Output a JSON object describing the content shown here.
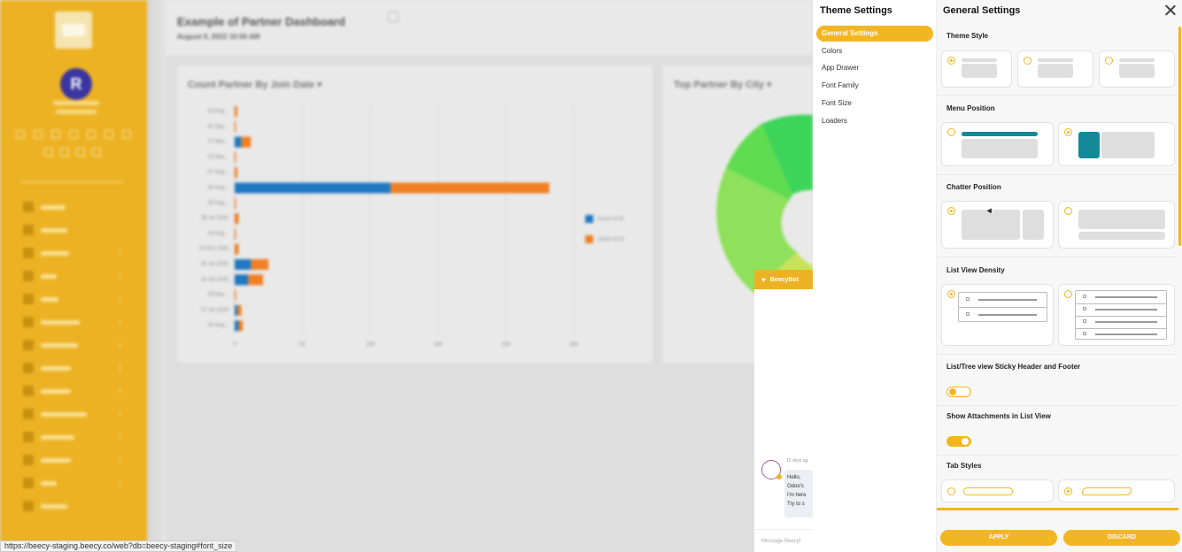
{
  "background": {
    "avatar_letter": "R",
    "title": "Example of Partner Dashboard",
    "date": "August 9, 2023 10:56 AM",
    "chart_card_title": "Count Partner By Join Date",
    "city_card_title": "Top Partner By City",
    "chart_data": {
      "type": "bar",
      "orientation": "horizontal",
      "stacked": true,
      "categories": [
        "23 Aug...",
        "18 Sep...",
        "27 Mar...",
        "13 Mar...",
        "07 Aug...",
        "28 Aug...",
        "25 Aug...",
        "26 Jul 2023",
        "19 Aug...",
        "03 Oct 2023",
        "25 Jul 2023",
        "24 Jul 2023",
        "29 Mar...",
        "27 Jul 2023",
        "16 Aug..."
      ],
      "series": [
        {
          "name": "Count of Id",
          "color": "#1f78c1",
          "values": [
            0,
            0,
            5,
            0,
            0,
            115,
            0,
            0,
            0,
            0,
            12,
            10,
            0,
            2,
            3
          ]
        },
        {
          "name": "Count of Id",
          "color": "#ef7f22",
          "values": [
            2,
            1,
            7,
            1,
            2,
            117,
            1,
            3,
            1,
            3,
            13,
            11,
            1,
            3,
            3
          ]
        }
      ],
      "xticks": [
        "0",
        "50",
        "100",
        "150",
        "200",
        "250"
      ],
      "xlim": [
        0,
        250
      ]
    },
    "chat": {
      "bot_name": "BeecyBot",
      "time": "15 days ag",
      "lines": [
        "Hello,",
        "Odoo's",
        "I'm here",
        "Try to s"
      ],
      "input_placeholder": "Message Beecyl"
    }
  },
  "theme_panel": {
    "title": "Theme Settings",
    "items": [
      {
        "label": "General Settings",
        "active": true
      },
      {
        "label": "Colors",
        "active": false
      },
      {
        "label": "App Drawer",
        "active": false
      },
      {
        "label": "Font Family",
        "active": false
      },
      {
        "label": "Font Size",
        "active": false
      },
      {
        "label": "Loaders",
        "active": false
      }
    ]
  },
  "general_panel": {
    "title": "General Settings",
    "sections": {
      "theme_style": "Theme Style",
      "menu_position": "Menu Position",
      "chatter_position": "Chatter Position",
      "list_density": "List View Density",
      "sticky_header": "List/Tree view Sticky Header and Footer",
      "show_attachments": "Show Attachments in List View",
      "tab_styles": "Tab Styles"
    },
    "toggles": {
      "sticky_header": false,
      "show_attachments": true
    },
    "buttons": {
      "apply": "APPLY",
      "discard": "DISCARD"
    }
  },
  "status_url": "https://beecy-staging.beecy.co/web?db=beecy-staging#font_size"
}
